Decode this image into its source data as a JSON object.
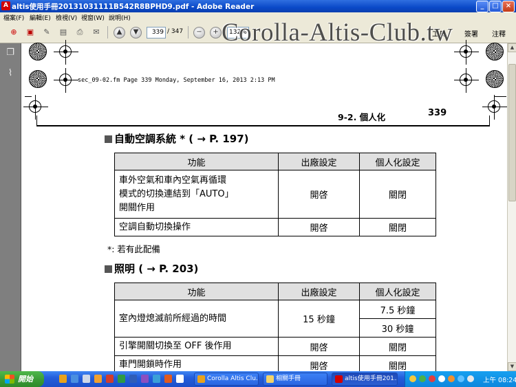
{
  "window": {
    "title": "altis使用手冊20131031111B542R8BPHD9.pdf - Adobe Reader",
    "min_label": "_",
    "max_label": "□",
    "close_label": "×"
  },
  "menu": [
    "檔案(F)",
    "編輯(E)",
    "檢視(V)",
    "視窗(W)",
    "說明(H)"
  ],
  "toolbar": {
    "page_current": "339",
    "page_total": "/ 347",
    "zoom": "132%",
    "tools_label": "工具",
    "comment_label": "簽署",
    "share_label": "注釋"
  },
  "watermark": "Corolla-Altis-Club.tw",
  "document": {
    "file_header": "sec_09-02.fm  Page 339  Monday, September 16, 2013  2:13 PM",
    "section_label": "9-2. 個人化",
    "page_number": "339",
    "heading1": "自動空調系統 * ( → P. 197)",
    "table1": {
      "headers": [
        "功能",
        "出廠設定",
        "個人化設定"
      ],
      "rows": [
        {
          "feature_lines": [
            "車外空氣和車內空氣再循環",
            "模式的切換連結到「AUTO」",
            "開關作用"
          ],
          "default": "開啓",
          "custom": "關閉"
        },
        {
          "feature_lines": [
            "空調自動切換操作"
          ],
          "default": "開啓",
          "custom": "關閉"
        }
      ]
    },
    "footnote": "*: 若有此配備",
    "heading2": "照明 ( → P. 203)",
    "table2": {
      "headers": [
        "功能",
        "出廠設定",
        "個人化設定"
      ],
      "row1_feature": "室內燈熄滅前所經過的時間",
      "row1_default": "15 秒鐘",
      "row1_custom_a": "7.5 秒鐘",
      "row1_custom_b": "30 秒鐘",
      "row2_feature": "引擎開關切換至 OFF 後作用",
      "row2_default": "開啓",
      "row2_custom": "關閉",
      "row3_feature": "車門開鎖時作用",
      "row3_default": "開啓",
      "row3_custom": "關閉"
    }
  },
  "taskbar": {
    "start_label": "開始",
    "tasks": [
      "Corolla Altis Clu...",
      "相關手冊",
      "altis使用手冊201..."
    ],
    "clock": "上午 08:24"
  }
}
